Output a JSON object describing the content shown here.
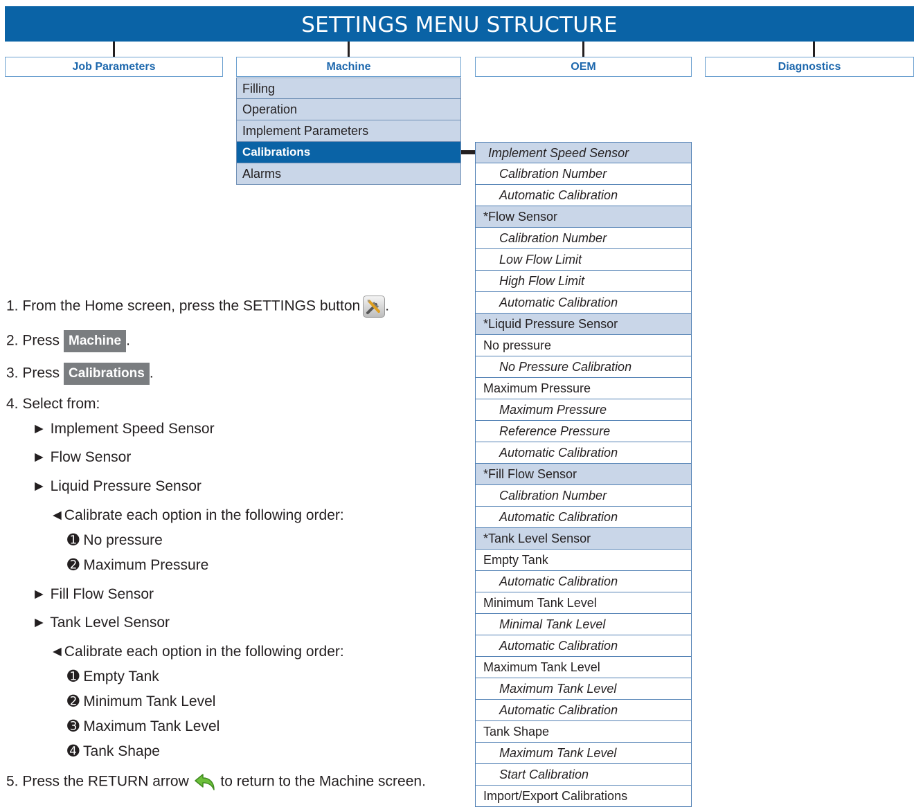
{
  "header": {
    "title": "SETTINGS MENU STRUCTURE"
  },
  "top_tabs": [
    "Job Parameters",
    "Machine",
    "OEM",
    "Diagnostics"
  ],
  "machine_menu": [
    "Filling",
    "Operation",
    "Implement Parameters",
    "Calibrations",
    "Alarms"
  ],
  "machine_menu_active": "Calibrations",
  "calibrations_list": [
    {
      "label": "Implement Speed Sensor",
      "style": "section-italic",
      "highlight": true
    },
    {
      "label": "Calibration Number",
      "style": "sub",
      "highlight": false
    },
    {
      "label": "Automatic Calibration",
      "style": "sub",
      "highlight": false
    },
    {
      "label": "*Flow Sensor",
      "style": "section",
      "highlight": true
    },
    {
      "label": "Calibration Number",
      "style": "sub",
      "highlight": false
    },
    {
      "label": "Low Flow Limit",
      "style": "sub",
      "highlight": false
    },
    {
      "label": "High Flow Limit",
      "style": "sub",
      "highlight": false
    },
    {
      "label": "Automatic Calibration",
      "style": "sub",
      "highlight": false
    },
    {
      "label": "*Liquid Pressure Sensor",
      "style": "section",
      "highlight": true
    },
    {
      "label": "No pressure",
      "style": "section",
      "highlight": false
    },
    {
      "label": "No Pressure Calibration",
      "style": "sub",
      "highlight": false
    },
    {
      "label": "Maximum Pressure",
      "style": "section",
      "highlight": false
    },
    {
      "label": "Maximum Pressure",
      "style": "sub",
      "highlight": false
    },
    {
      "label": "Reference Pressure",
      "style": "sub",
      "highlight": false
    },
    {
      "label": "Automatic Calibration",
      "style": "sub",
      "highlight": false
    },
    {
      "label": "*Fill Flow Sensor",
      "style": "section",
      "highlight": true
    },
    {
      "label": "Calibration Number",
      "style": "sub",
      "highlight": false
    },
    {
      "label": "Automatic Calibration",
      "style": "sub",
      "highlight": false
    },
    {
      "label": "*Tank Level Sensor",
      "style": "section",
      "highlight": true
    },
    {
      "label": "Empty Tank",
      "style": "section",
      "highlight": false
    },
    {
      "label": "Automatic Calibration",
      "style": "sub",
      "highlight": false
    },
    {
      "label": "Minimum Tank Level",
      "style": "section",
      "highlight": false
    },
    {
      "label": "Minimal Tank Level",
      "style": "sub",
      "highlight": false
    },
    {
      "label": "Automatic Calibration",
      "style": "sub",
      "highlight": false
    },
    {
      "label": "Maximum Tank Level",
      "style": "section",
      "highlight": false
    },
    {
      "label": "Maximum Tank Level",
      "style": "sub",
      "highlight": false
    },
    {
      "label": "Automatic Calibration",
      "style": "sub",
      "highlight": false
    },
    {
      "label": "Tank Shape",
      "style": "section",
      "highlight": false
    },
    {
      "label": "Maximum Tank Level",
      "style": "sub",
      "highlight": false
    },
    {
      "label": "Start Calibration",
      "style": "sub",
      "highlight": false
    },
    {
      "label": "Import/Export Calibrations",
      "style": "section",
      "highlight": false
    }
  ],
  "instructions": {
    "step1_prefix": "1. From the Home screen, press the SETTINGS button",
    "step1_suffix": ".",
    "step2_prefix": "2. Press",
    "step2_button": "Machine",
    "step2_suffix": ".",
    "step3_prefix": "3. Press",
    "step3_button": "Calibrations",
    "step3_suffix": ".",
    "step4": "4. Select from:",
    "opt1": "► Implement Speed Sensor",
    "opt2": "► Flow Sensor",
    "opt3": "► Liquid Pressure Sensor",
    "order_note_1": "◄Calibrate each option in the following order:",
    "lp1": "➊ No pressure",
    "lp2": "➋ Maximum Pressure",
    "opt4": "► Fill Flow Sensor",
    "opt5": "► Tank Level Sensor",
    "order_note_2": "◄Calibrate each option in the following order:",
    "tl1": "➊ Empty Tank",
    "tl2": "➋ Minimum Tank Level",
    "tl3": "➌ Maximum Tank Level",
    "tl4": "➍ Tank Shape",
    "step5_prefix": "5. Press the RETURN arrow",
    "step5_suffix": "to return to the Machine screen."
  },
  "icons": {
    "settings": "settings-tools-icon",
    "return": "return-arrow-icon"
  },
  "colors": {
    "banner": "#0a63a6",
    "menu_bg": "#c9d6e8",
    "button_gray": "#7a7d80",
    "tab_text": "#1c67ad"
  }
}
